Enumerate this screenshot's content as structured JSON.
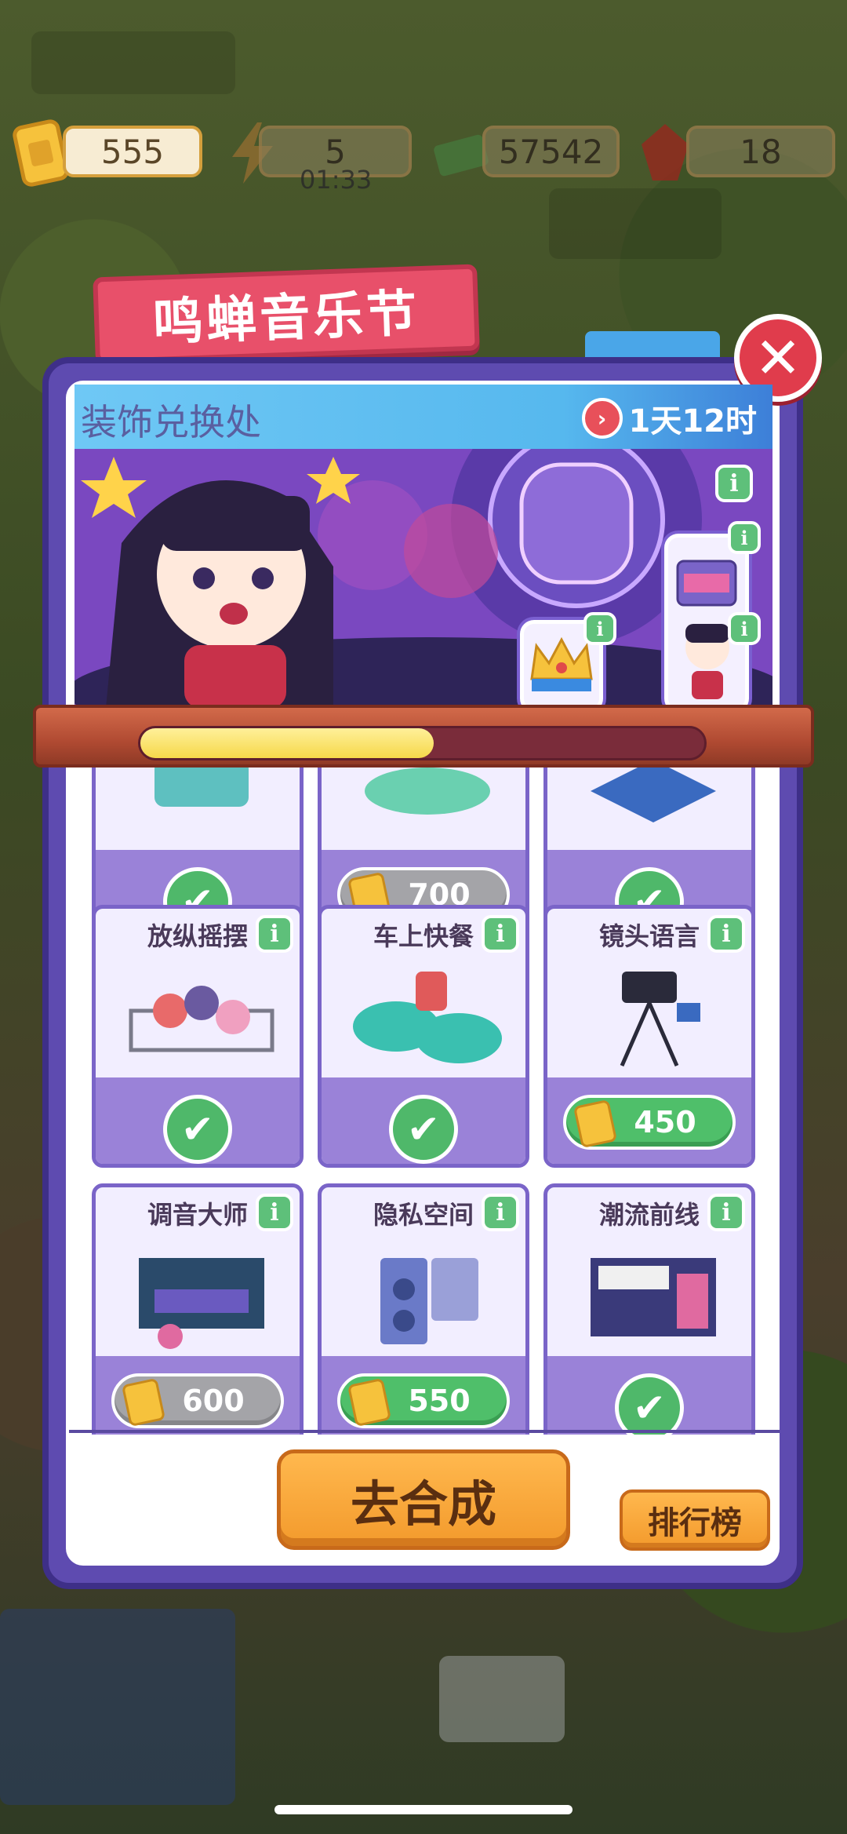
{
  "resources": {
    "tickets": "555",
    "energy": "5",
    "energy_timer": "01:33",
    "cash": "57542",
    "gems": "18"
  },
  "event": {
    "title": "鸣蝉音乐节",
    "section_title": "装饰兑换处",
    "time_left": "1天12时",
    "progress": 0.52
  },
  "items": [
    {
      "name": "",
      "status": "owned",
      "price": ""
    },
    {
      "name": "",
      "status": "price",
      "price": "700",
      "price_style": "gray"
    },
    {
      "name": "",
      "status": "owned",
      "price": ""
    },
    {
      "name": "放纵摇摆",
      "status": "owned",
      "price": ""
    },
    {
      "name": "车上快餐",
      "status": "owned",
      "price": ""
    },
    {
      "name": "镜头语言",
      "status": "price",
      "price": "450",
      "price_style": "green"
    },
    {
      "name": "调音大师",
      "status": "price",
      "price": "600",
      "price_style": "gray"
    },
    {
      "name": "隐私空间",
      "status": "price",
      "price": "550",
      "price_style": "green"
    },
    {
      "name": "潮流前线",
      "status": "owned",
      "price": ""
    }
  ],
  "buttons": {
    "merge": "去合成",
    "leaderboard": "排行榜",
    "close": "✕",
    "info": "i"
  },
  "icons": {
    "check": "✔",
    "clock": "›"
  },
  "colors": {
    "panel": "#5e4bb0",
    "banner": "#e8506a",
    "accent_orange": "#f39a2c",
    "check_green": "#4fb86a"
  }
}
